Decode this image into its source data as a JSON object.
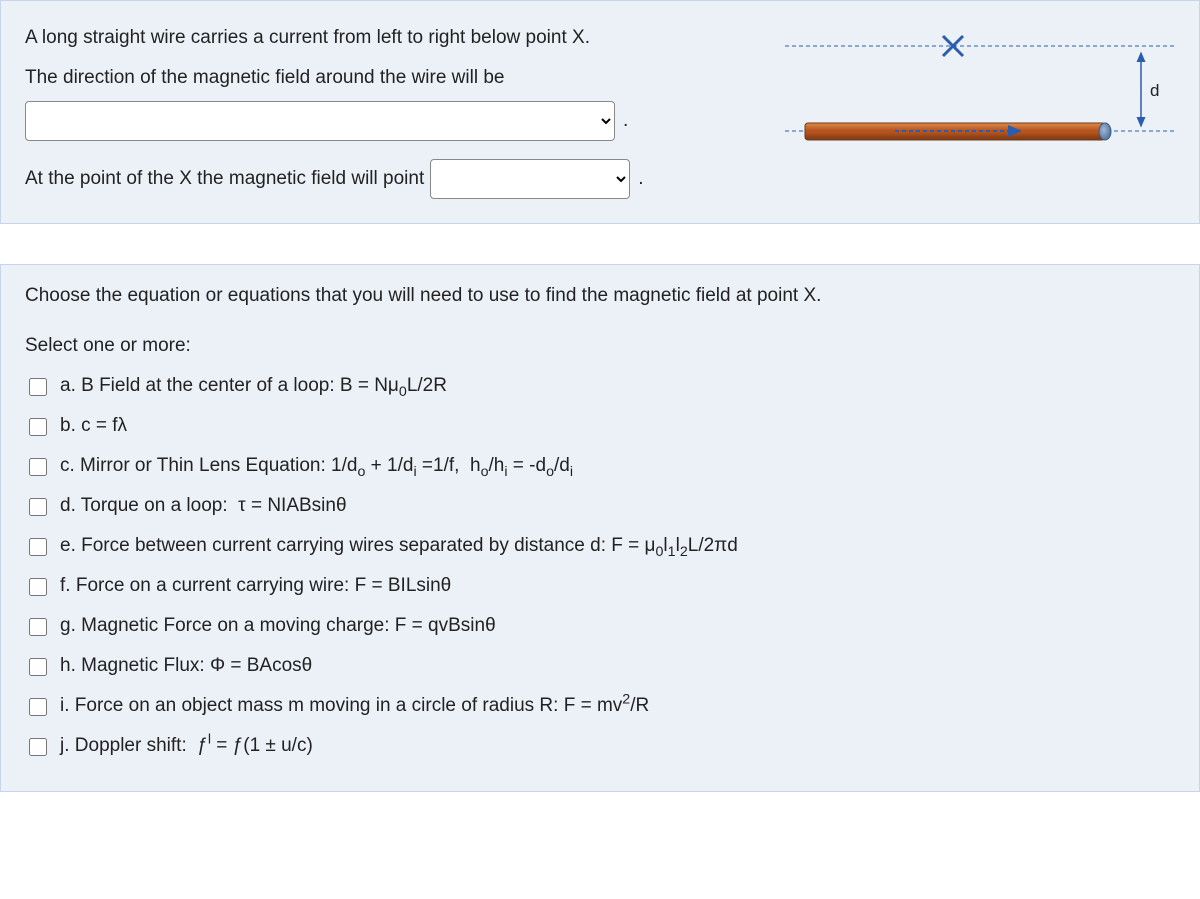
{
  "q1": {
    "line1": "A long straight wire carries a current from left to right below point X.",
    "line2": "The direction of the magnetic field around the wire will be",
    "line3_prefix": "At the point of the X the magnetic field will point",
    "period": ".",
    "diagram": {
      "x_label": "X",
      "d_label": "d"
    }
  },
  "q2": {
    "prompt": "Choose the equation or equations that you will need to use to find the magnetic field at point X.",
    "instruction": "Select one or more:",
    "options": [
      {
        "letter": "a.",
        "html": "B Field at the center of a loop: B = Nμ<sub>0</sub>L/2R"
      },
      {
        "letter": "b.",
        "html": "c = fλ"
      },
      {
        "letter": "c.",
        "html": "Mirror or Thin Lens Equation: 1/d<sub>o</sub> + 1/d<sub>i</sub> =1/f,&nbsp; h<sub>o</sub>/h<sub>i</sub> = -d<sub>o</sub>/d<sub>i</sub>"
      },
      {
        "letter": "d.",
        "html": "Torque on a loop:&nbsp; τ = NIABsinθ"
      },
      {
        "letter": "e.",
        "html": "Force between current carrying wires separated by distance d: F = μ<sub>0</sub>l<sub>1</sub>l<sub>2</sub>L/2πd"
      },
      {
        "letter": "f.",
        "html": "Force on a current carrying wire: F = BILsinθ"
      },
      {
        "letter": "g.",
        "html": "Magnetic Force on a moving charge: F = qvBsinθ"
      },
      {
        "letter": "h.",
        "html": "Magnetic Flux: Φ = BAcosθ"
      },
      {
        "letter": "i.",
        "html": "Force on an object mass m moving in a circle of radius R: F = mv<sup>2</sup>/R"
      },
      {
        "letter": "j.",
        "html": "Doppler shift:&nbsp; ƒ<sup>l</sup> = ƒ(1 ± u/c)"
      }
    ]
  }
}
